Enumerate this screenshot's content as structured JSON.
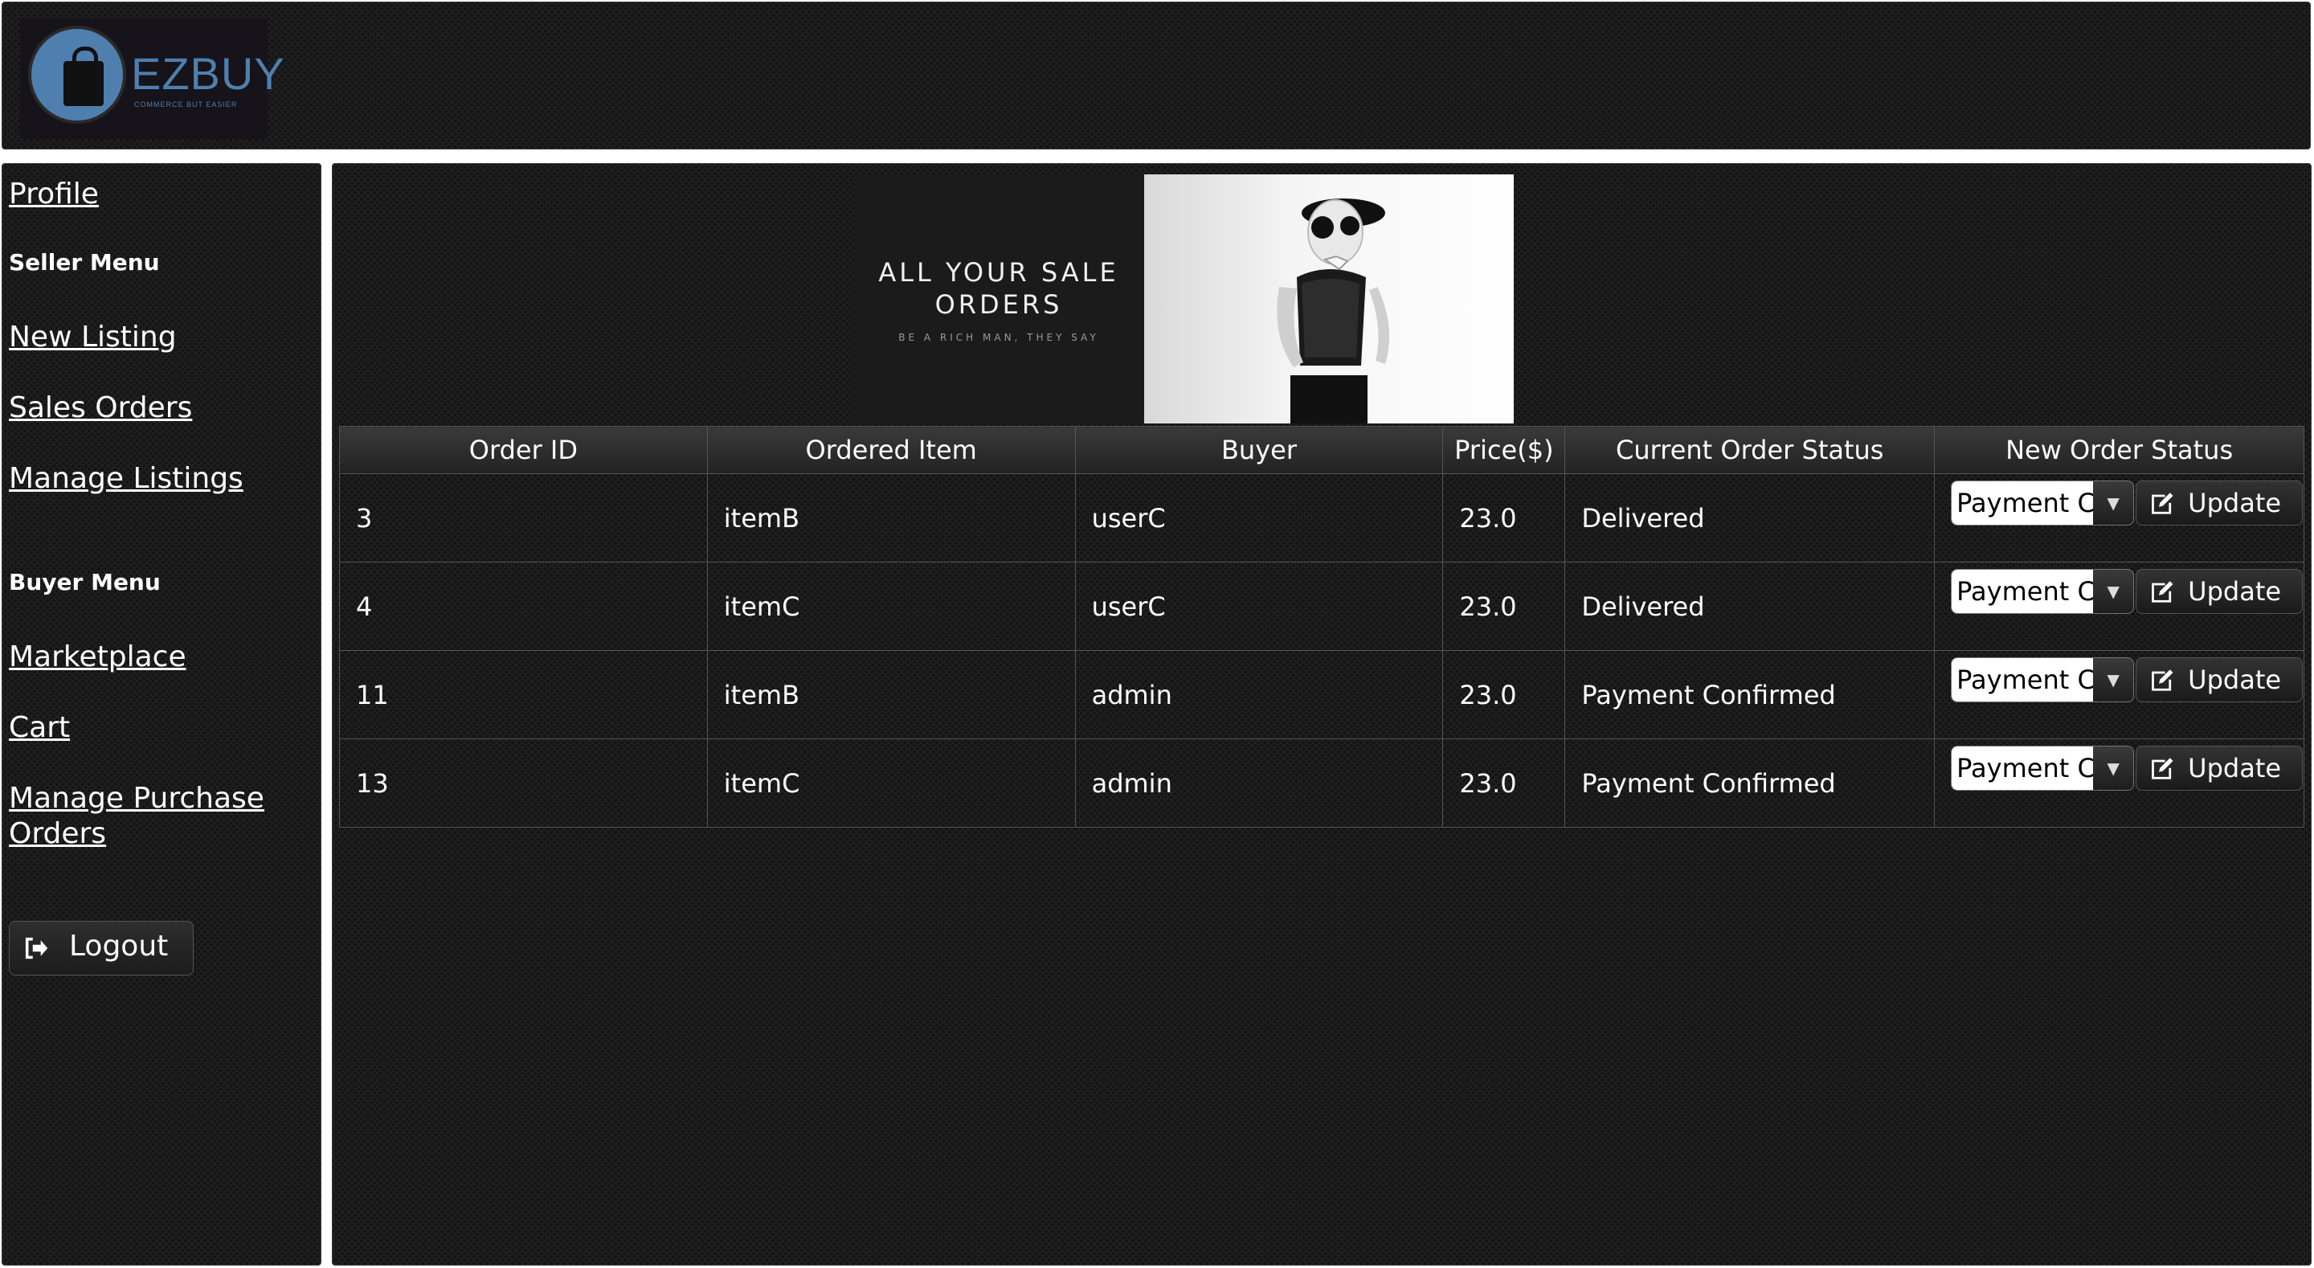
{
  "header": {
    "brand": "EZBUY",
    "tagline": "COMMERCE BUT EASIER"
  },
  "sidebar": {
    "profile": "Profile",
    "seller_heading": "Seller Menu",
    "seller_items": [
      "New Listing",
      "Sales Orders",
      "Manage Listings"
    ],
    "buyer_heading": "Buyer Menu",
    "buyer_items": [
      "Marketplace",
      "Cart",
      "Manage Purchase Orders"
    ],
    "logout": "Logout"
  },
  "banner": {
    "title": "ALL YOUR SALE ORDERS",
    "subtitle": "BE A RICH MAN, THEY SAY"
  },
  "table": {
    "columns": [
      "Order ID",
      "Ordered Item",
      "Buyer",
      "Price($)",
      "Current Order Status",
      "New Order Status"
    ],
    "rows": [
      {
        "order_id": "3",
        "item": "itemB",
        "buyer": "userC",
        "price": "23.0",
        "status": "Delivered",
        "new_status": "Payment Confirmed",
        "button": "Update"
      },
      {
        "order_id": "4",
        "item": "itemC",
        "buyer": "userC",
        "price": "23.0",
        "status": "Delivered",
        "new_status": "Payment Confirmed",
        "button": "Update"
      },
      {
        "order_id": "11",
        "item": "itemB",
        "buyer": "admin",
        "price": "23.0",
        "status": "Payment Confirmed",
        "new_status": "Payment Confirmed",
        "button": "Update"
      },
      {
        "order_id": "13",
        "item": "itemC",
        "buyer": "admin",
        "price": "23.0",
        "status": "Payment Confirmed",
        "new_status": "Payment Confirmed",
        "button": "Update"
      }
    ]
  },
  "colors": {
    "brand": "#4e7fae",
    "background": "#141414"
  }
}
